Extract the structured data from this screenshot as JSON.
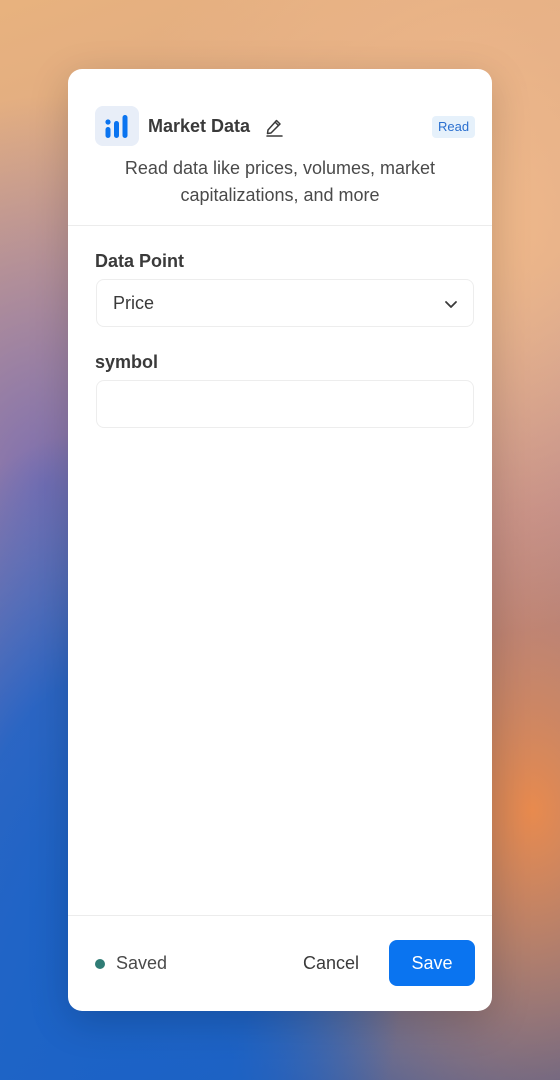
{
  "app": {
    "title": "Market Data",
    "badge": "Read",
    "description": "Read data like prices, volumes, market capitalizations, and more",
    "icon": "bar-chart-icon",
    "accent_color": "#0a74f0"
  },
  "form": {
    "data_point": {
      "label": "Data Point",
      "selected": "Price"
    },
    "symbol": {
      "label": "symbol",
      "value": "",
      "placeholder": ""
    }
  },
  "footer": {
    "status": "Saved",
    "status_color": "#2f7c75",
    "cancel_label": "Cancel",
    "save_label": "Save"
  }
}
